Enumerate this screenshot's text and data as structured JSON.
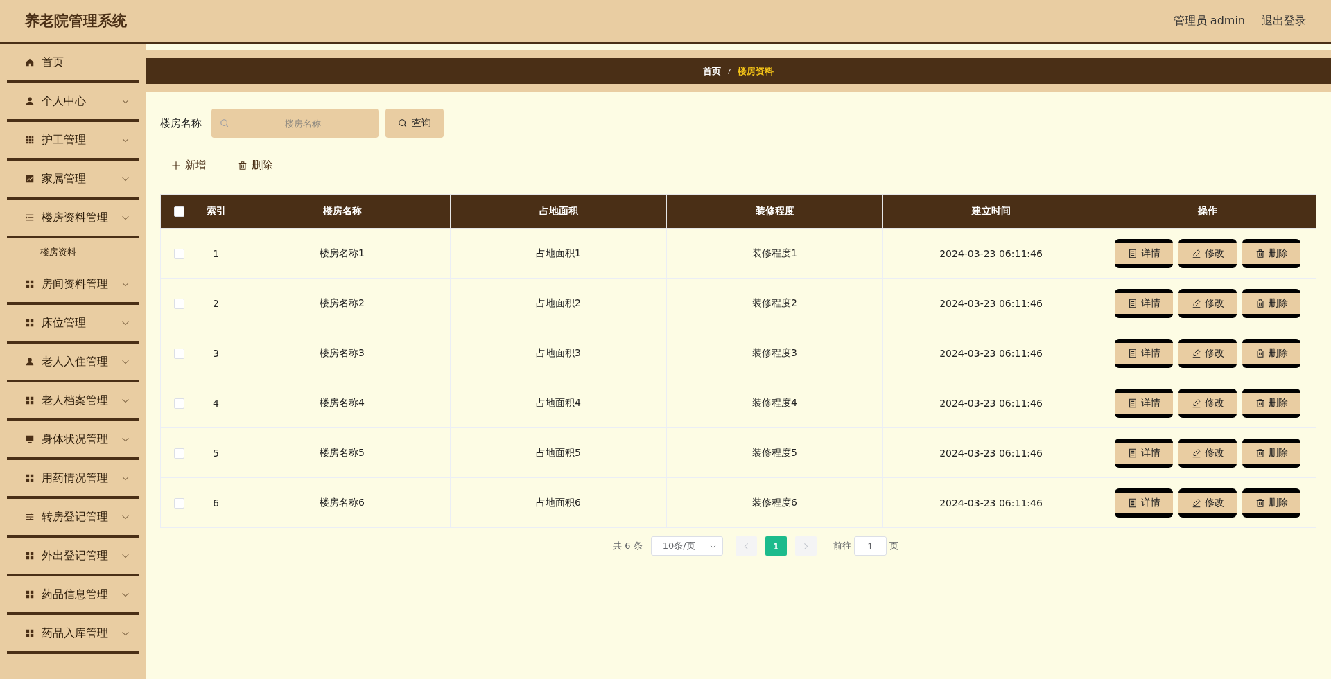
{
  "header": {
    "title": "养老院管理系统",
    "user": "管理员 admin",
    "logout": "退出登录"
  },
  "sidebar": {
    "items": [
      {
        "label": "首页",
        "kind": "home",
        "expandable": false
      },
      {
        "label": "个人中心",
        "kind": "user",
        "expandable": true
      },
      {
        "label": "护工管理",
        "kind": "grid9",
        "expandable": true
      },
      {
        "label": "家属管理",
        "kind": "chart",
        "expandable": true
      },
      {
        "label": "楼房资料管理",
        "kind": "list",
        "expandable": true,
        "children": [
          {
            "label": "楼房资料"
          }
        ]
      },
      {
        "label": "房间资料管理",
        "kind": "grid4",
        "expandable": true
      },
      {
        "label": "床位管理",
        "kind": "grid4",
        "expandable": true
      },
      {
        "label": "老人入住管理",
        "kind": "user",
        "expandable": true
      },
      {
        "label": "老人档案管理",
        "kind": "grid4",
        "expandable": true
      },
      {
        "label": "身体状况管理",
        "kind": "monitor",
        "expandable": true
      },
      {
        "label": "用药情况管理",
        "kind": "grid4",
        "expandable": true
      },
      {
        "label": "转房登记管理",
        "kind": "sliders",
        "expandable": true
      },
      {
        "label": "外出登记管理",
        "kind": "grid4",
        "expandable": true
      },
      {
        "label": "药品信息管理",
        "kind": "grid4",
        "expandable": true
      },
      {
        "label": "药品入库管理",
        "kind": "grid4",
        "expandable": true
      }
    ]
  },
  "breadcrumb": [
    {
      "label": "首页",
      "current": false
    },
    {
      "label": "楼房资料",
      "current": true
    }
  ],
  "search": {
    "label": "楼房名称",
    "placeholder": "楼房名称",
    "button": "查询"
  },
  "actions": [
    {
      "kind": "add",
      "label": "新增"
    },
    {
      "kind": "delete",
      "label": "删除"
    }
  ],
  "table": {
    "select_all": {
      "checked": false
    },
    "columns": [
      "索引",
      "楼房名称",
      "占地面积",
      "装修程度",
      "建立时间",
      "操作"
    ],
    "rows": [
      {
        "checked": false,
        "cells": [
          "1",
          "楼房名称1",
          "占地面积1",
          "装修程度1",
          "2024-03-23 06:11:46"
        ],
        "actions": [
          {
            "kind": "detail",
            "label": "详情"
          },
          {
            "kind": "edit",
            "label": "修改"
          },
          {
            "kind": "delete",
            "label": "删除"
          }
        ]
      },
      {
        "checked": false,
        "cells": [
          "2",
          "楼房名称2",
          "占地面积2",
          "装修程度2",
          "2024-03-23 06:11:46"
        ],
        "actions": [
          {
            "kind": "detail",
            "label": "详情"
          },
          {
            "kind": "edit",
            "label": "修改"
          },
          {
            "kind": "delete",
            "label": "删除"
          }
        ]
      },
      {
        "checked": false,
        "cells": [
          "3",
          "楼房名称3",
          "占地面积3",
          "装修程度3",
          "2024-03-23 06:11:46"
        ],
        "actions": [
          {
            "kind": "detail",
            "label": "详情"
          },
          {
            "kind": "edit",
            "label": "修改"
          },
          {
            "kind": "delete",
            "label": "删除"
          }
        ]
      },
      {
        "checked": false,
        "cells": [
          "4",
          "楼房名称4",
          "占地面积4",
          "装修程度4",
          "2024-03-23 06:11:46"
        ],
        "actions": [
          {
            "kind": "detail",
            "label": "详情"
          },
          {
            "kind": "edit",
            "label": "修改"
          },
          {
            "kind": "delete",
            "label": "删除"
          }
        ]
      },
      {
        "checked": false,
        "cells": [
          "5",
          "楼房名称5",
          "占地面积5",
          "装修程度5",
          "2024-03-23 06:11:46"
        ],
        "actions": [
          {
            "kind": "detail",
            "label": "详情"
          },
          {
            "kind": "edit",
            "label": "修改"
          },
          {
            "kind": "delete",
            "label": "删除"
          }
        ]
      },
      {
        "checked": false,
        "cells": [
          "6",
          "楼房名称6",
          "占地面积6",
          "装修程度6",
          "2024-03-23 06:11:46"
        ],
        "actions": [
          {
            "kind": "detail",
            "label": "详情"
          },
          {
            "kind": "edit",
            "label": "修改"
          },
          {
            "kind": "delete",
            "label": "删除"
          }
        ]
      }
    ]
  },
  "pagination": {
    "total": "共 6 条",
    "page_size": "10条/页",
    "pages": [
      {
        "label": "1",
        "selected": true
      }
    ],
    "goto_label": "前往",
    "goto_value": "1",
    "goto_suffix": "页"
  }
}
